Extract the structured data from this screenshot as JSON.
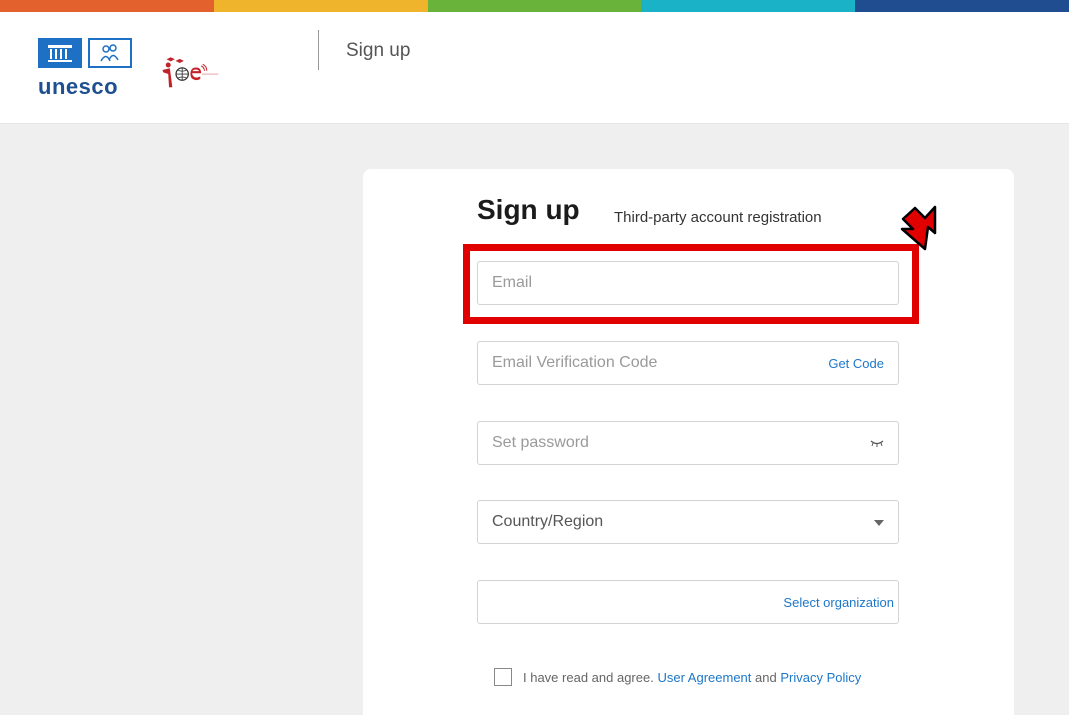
{
  "colors": {
    "accent_link": "#1d77c9",
    "highlight": "#e00000",
    "rainbow": [
      "#e2612c",
      "#f0b42c",
      "#69b33b",
      "#1ab2c6",
      "#1f4d8f",
      "#7b3aa8"
    ]
  },
  "header": {
    "unesco_word": "unesco",
    "title": "Sign up"
  },
  "form": {
    "title": "Sign up",
    "subtitle": "Third-party account registration",
    "email_placeholder": "Email",
    "code_placeholder": "Email Verification Code",
    "get_code": "Get Code",
    "password_placeholder": "Set password",
    "country_label": "Country/Region",
    "org_action": "Select organization",
    "agree_text": "I have read and agree.",
    "user_agreement": "User Agreement",
    "and": "and",
    "privacy_policy": "Privacy Policy"
  },
  "icons": {
    "password_toggle": "eye-closed-icon",
    "country_dropdown": "caret-down-icon",
    "annotation": "red-arrow-icon"
  }
}
